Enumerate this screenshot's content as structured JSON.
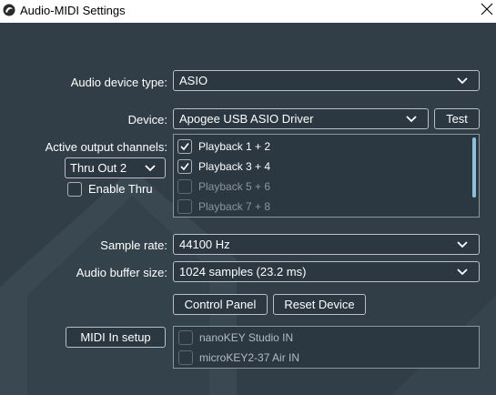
{
  "window": {
    "title": "Audio-MIDI Settings",
    "close_glyph": "×"
  },
  "audio_device_type": {
    "label": "Audio device type:",
    "value": "ASIO"
  },
  "device": {
    "label": "Device:",
    "value": "Apogee USB ASIO Driver",
    "test_label": "Test"
  },
  "output_channels": {
    "label": "Active output channels:",
    "items": [
      {
        "label": "Playback 1 + 2",
        "checked": true
      },
      {
        "label": "Playback 3 + 4",
        "checked": true
      },
      {
        "label": "Playback 5 + 6",
        "checked": false
      },
      {
        "label": "Playback 7 + 8",
        "checked": false
      }
    ]
  },
  "thru": {
    "select_value": "Thru Out 2",
    "enable_label": "Enable Thru",
    "enabled": false
  },
  "sample_rate": {
    "label": "Sample rate:",
    "value": "44100 Hz"
  },
  "buffer_size": {
    "label": "Audio buffer size:",
    "value": "1024 samples (23.2 ms)"
  },
  "buttons": {
    "control_panel": "Control Panel",
    "reset_device": "Reset Device"
  },
  "midi": {
    "setup_label": "MIDI In setup",
    "inputs": [
      {
        "label": "nanoKEY Studio IN",
        "checked": false
      },
      {
        "label": "microKEY2-37 Air IN",
        "checked": false
      }
    ]
  },
  "colors": {
    "background": "#313e48",
    "control": "#2b3741",
    "scroll_accent": "#8fbedc"
  },
  "icons": {
    "app": "app-logo-icon",
    "close": "close-icon",
    "dropdown": "chevron-down-icon",
    "check": "checkmark-icon"
  }
}
